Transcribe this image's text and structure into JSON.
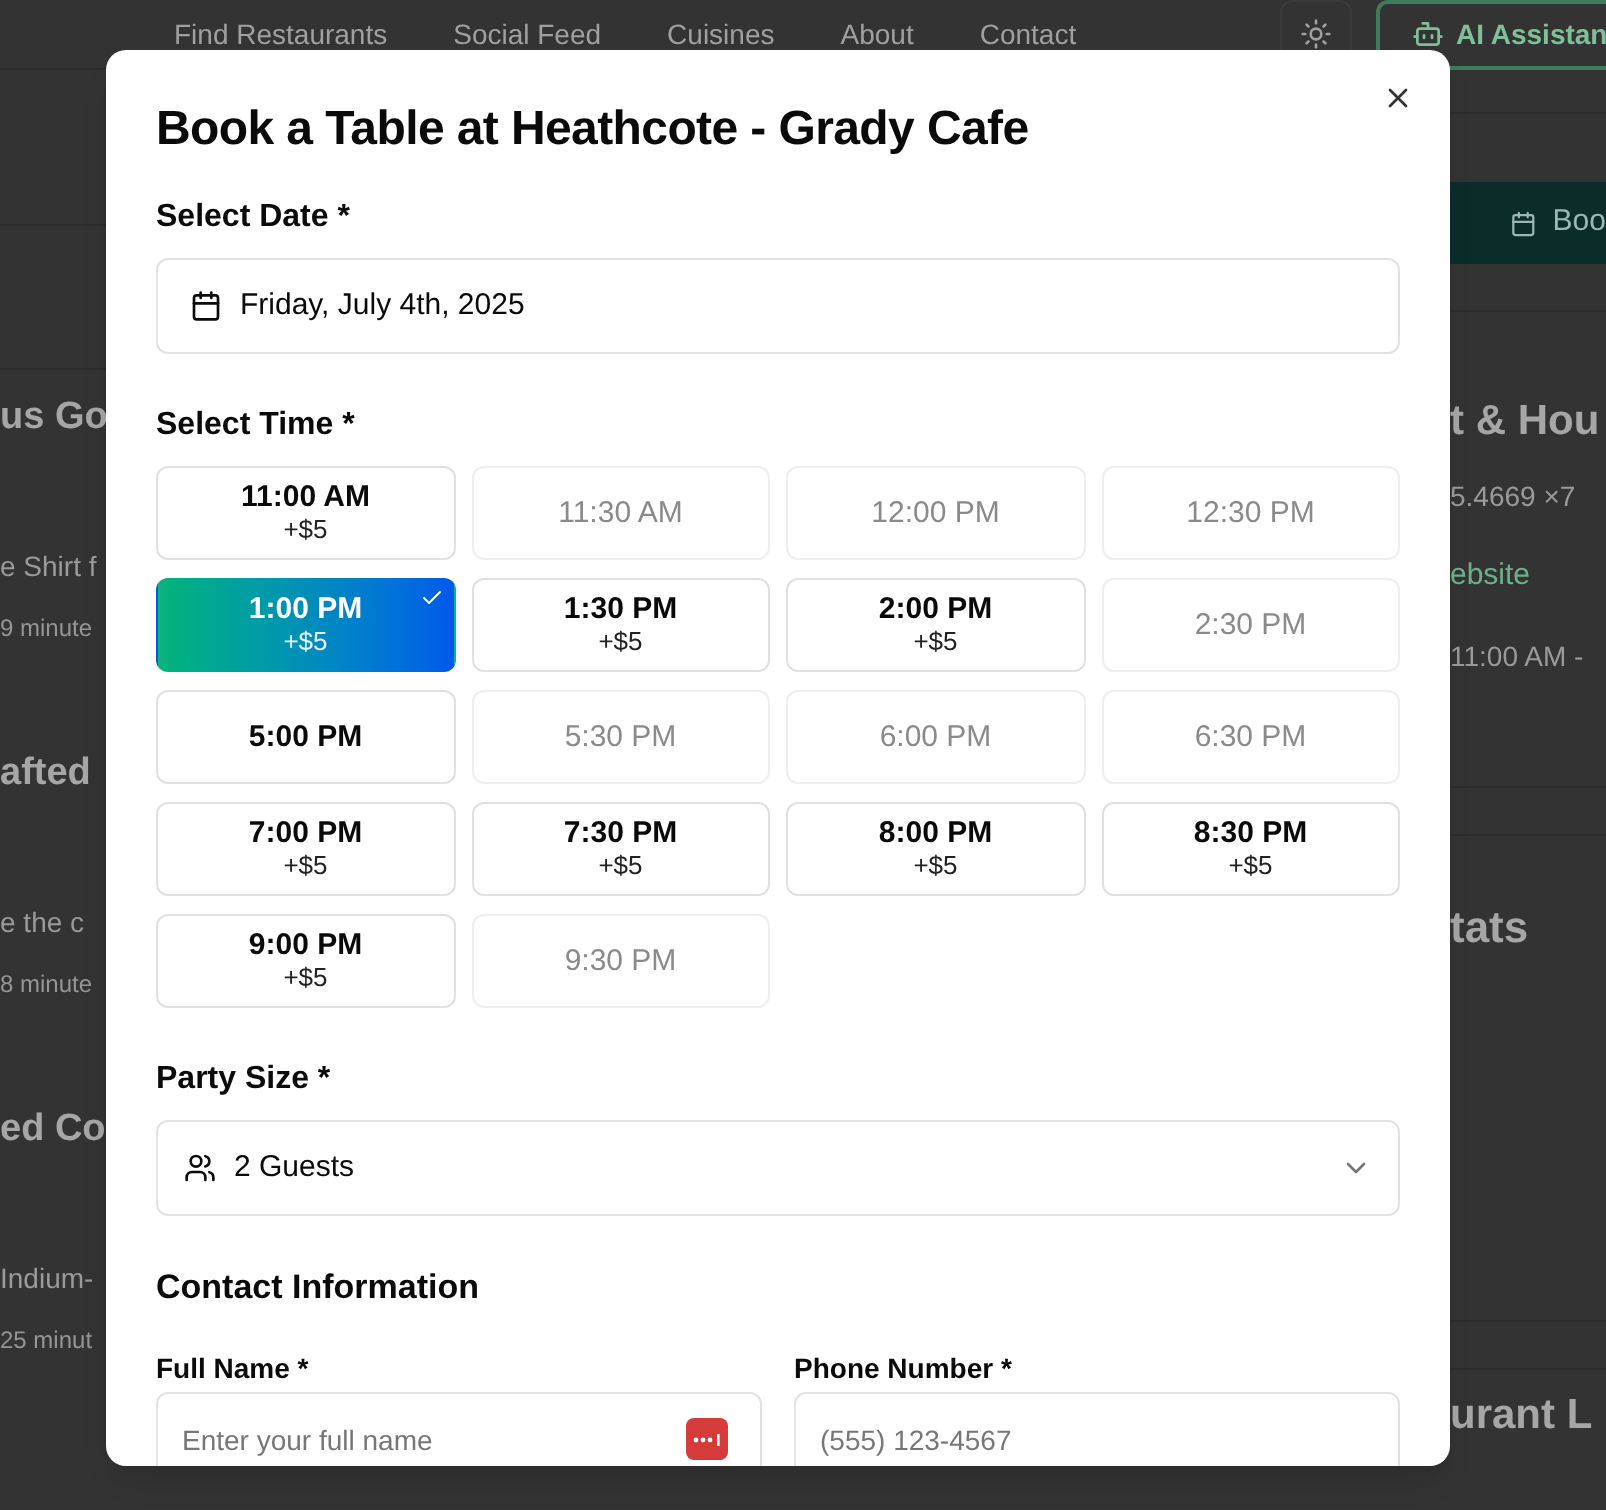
{
  "nav": {
    "links": [
      "Find Restaurants",
      "Social Feed",
      "Cuisines",
      "About",
      "Contact"
    ],
    "assistant_button": "AI Assistan"
  },
  "left_fragments": [
    {
      "kind": "heading",
      "text": "us Go"
    },
    {
      "kind": "body",
      "text": "e Shirt f"
    },
    {
      "kind": "meta",
      "text": "9 minute"
    },
    {
      "kind": "heading",
      "text": "afted"
    },
    {
      "kind": "body",
      "text": "e the c"
    },
    {
      "kind": "meta",
      "text": "8 minute"
    },
    {
      "kind": "heading",
      "text": "ed Co"
    },
    {
      "kind": "body",
      "text": "Indium-"
    },
    {
      "kind": "meta",
      "text": "25 minut"
    }
  ],
  "right_panel": {
    "button": "Boo",
    "heading_1": "t & Hou",
    "coords": "5.4669 ×7",
    "website": "ebsite",
    "hours": "11:00 AM -",
    "heading_2": "tats",
    "heading_3": "urant L"
  },
  "dialog": {
    "title": "Book a Table at Heathcote - Grady Cafe",
    "date_label": "Select Date *",
    "date_value": "Friday, July 4th, 2025",
    "time_label": "Select Time *",
    "slots": [
      {
        "time": "11:00 AM",
        "surcharge": "+$5",
        "available": true,
        "selected": false
      },
      {
        "time": "11:30 AM",
        "available": false,
        "selected": false
      },
      {
        "time": "12:00 PM",
        "available": false,
        "selected": false
      },
      {
        "time": "12:30 PM",
        "available": false,
        "selected": false
      },
      {
        "time": "1:00 PM",
        "surcharge": "+$5",
        "available": true,
        "selected": true
      },
      {
        "time": "1:30 PM",
        "surcharge": "+$5",
        "available": true,
        "selected": false
      },
      {
        "time": "2:00 PM",
        "surcharge": "+$5",
        "available": true,
        "selected": false
      },
      {
        "time": "2:30 PM",
        "available": false,
        "selected": false
      },
      {
        "time": "5:00 PM",
        "available": true,
        "selected": false
      },
      {
        "time": "5:30 PM",
        "available": false,
        "selected": false
      },
      {
        "time": "6:00 PM",
        "available": false,
        "selected": false
      },
      {
        "time": "6:30 PM",
        "available": false,
        "selected": false
      },
      {
        "time": "7:00 PM",
        "surcharge": "+$5",
        "available": true,
        "selected": false
      },
      {
        "time": "7:30 PM",
        "surcharge": "+$5",
        "available": true,
        "selected": false
      },
      {
        "time": "8:00 PM",
        "surcharge": "+$5",
        "available": true,
        "selected": false
      },
      {
        "time": "8:30 PM",
        "surcharge": "+$5",
        "available": true,
        "selected": false
      },
      {
        "time": "9:00 PM",
        "surcharge": "+$5",
        "available": true,
        "selected": false
      },
      {
        "time": "9:30 PM",
        "available": false,
        "selected": false
      }
    ],
    "party_label": "Party Size *",
    "party_value": "2 Guests",
    "contact_heading": "Contact Information",
    "name_label": "Full Name *",
    "name_placeholder": "Enter your full name",
    "phone_label": "Phone Number *",
    "phone_placeholder": "(555) 123-4567"
  }
}
